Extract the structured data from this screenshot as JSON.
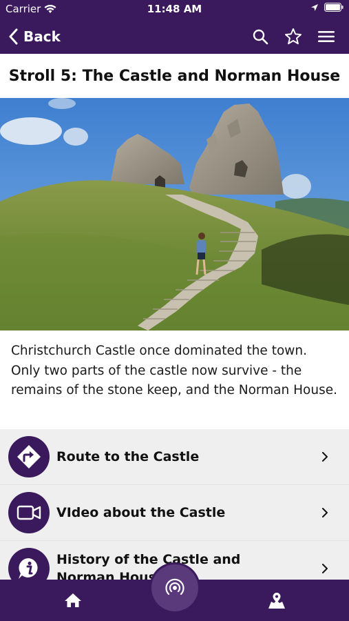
{
  "status_bar": {
    "carrier": "Carrier",
    "time": "11:48 AM"
  },
  "nav": {
    "back_label": "Back",
    "icons": [
      "search-icon",
      "star-icon",
      "hamburger-menu-icon"
    ]
  },
  "page": {
    "title": "Stroll 5: The Castle and Norman House",
    "intro": "Christchurch Castle once dominated the town. Only two parts of the castle now survive - the remains of the stone keep, and the Norman House."
  },
  "menu": {
    "items": [
      {
        "label": "Route to the Castle",
        "icon": "directions-icon"
      },
      {
        "label": "VIdeo about the Castle",
        "icon": "video-camera-icon"
      },
      {
        "label": "History of the Castle and Norman House",
        "icon": "info-icon"
      }
    ]
  },
  "tab_bar": {
    "icons": [
      "home-icon",
      "beacon-icon",
      "map-icon"
    ]
  },
  "colors": {
    "brand": "#3a1a5c",
    "center_button": "#5a3a7a",
    "list_background": "#efefef"
  }
}
